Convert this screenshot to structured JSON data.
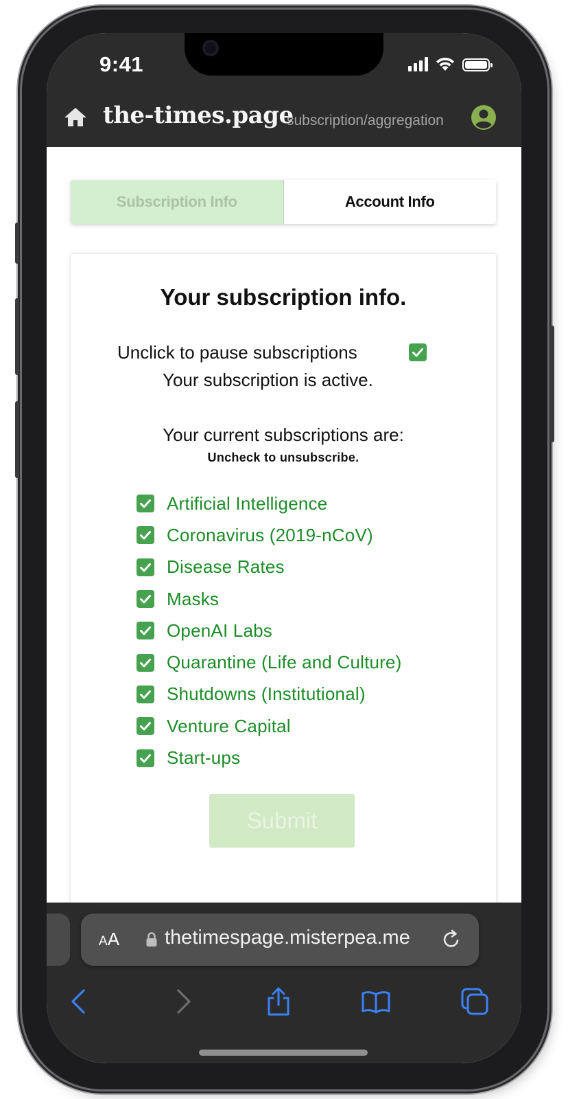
{
  "status_bar": {
    "time": "9:41"
  },
  "header": {
    "brand": "the-times.page",
    "path": "subscription/aggregation"
  },
  "tabs": [
    {
      "label": "Subscription Info"
    },
    {
      "label": "Account Info"
    }
  ],
  "card": {
    "title": "Your subscription info.",
    "pause_label": "Unclick to pause subscriptions",
    "active_status": "Your subscription is active.",
    "current_label": "Your current subscriptions are:",
    "uncheck_hint": "Uncheck to unsubscribe.",
    "topics": [
      {
        "label": "Artificial Intelligence"
      },
      {
        "label": "Coronavirus (2019-nCoV)"
      },
      {
        "label": "Disease Rates"
      },
      {
        "label": "Masks"
      },
      {
        "label": "OpenAI Labs"
      },
      {
        "label": "Quarantine (Life and Culture)"
      },
      {
        "label": "Shutdowns (Institutional)"
      },
      {
        "label": "Venture Capital"
      },
      {
        "label": "Start-ups"
      }
    ],
    "submit_label": "Submit"
  },
  "browser": {
    "aa_small": "A",
    "aa_big": "A",
    "url": "thetimespage.misterpea.me"
  },
  "colors": {
    "checkbox_green": "#46a24f",
    "topic_text": "#1c8c27",
    "active_tab_bg": "#d4efcf",
    "submit_bg": "#d1e9c5",
    "header_bg": "#2c2c2c",
    "safari_blue": "#3b82f6"
  }
}
